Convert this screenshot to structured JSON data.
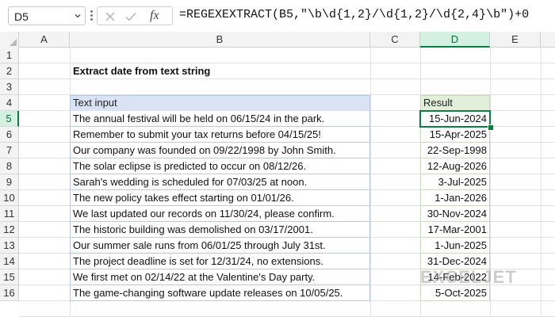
{
  "toolbar": {
    "name_box": "D5",
    "formula": "=REGEXEXTRACT(B5,\"\\b\\d{1,2}/\\d{1,2}/\\d{2,4}\\b\")+0",
    "fx_label": "fx",
    "cancel_icon": "x-icon",
    "enter_icon": "check-icon"
  },
  "columns": [
    "A",
    "B",
    "C",
    "D",
    "E"
  ],
  "selected_column": "D",
  "rows": [
    "1",
    "2",
    "3",
    "4",
    "5",
    "6",
    "7",
    "8",
    "9",
    "10",
    "11",
    "12",
    "13",
    "14",
    "15",
    "16"
  ],
  "selected_row": "5",
  "sheet": {
    "title": "Extract date from text string",
    "text_header": "Text input",
    "result_header": "Result",
    "entries": [
      {
        "text": "The annual festival will be held on 06/15/24 in the park.",
        "result": "15-Jun-2024"
      },
      {
        "text": "Remember to submit your tax returns before 04/15/25!",
        "result": "15-Apr-2025"
      },
      {
        "text": "Our company was founded on 09/22/1998 by John Smith.",
        "result": "22-Sep-1998"
      },
      {
        "text": "The solar eclipse is predicted to occur on 08/12/26.",
        "result": "12-Aug-2026"
      },
      {
        "text": "Sarah's wedding is scheduled for 07/03/25 at noon.",
        "result": "3-Jul-2025"
      },
      {
        "text": "The new policy takes effect starting on 01/01/26.",
        "result": "1-Jan-2026"
      },
      {
        "text": "We last updated our records on 11/30/24, please confirm.",
        "result": "30-Nov-2024"
      },
      {
        "text": "The historic building was demolished on 03/17/2001.",
        "result": "17-Mar-2001"
      },
      {
        "text": "Our summer sale runs from 06/01/25 through July 31st.",
        "result": "1-Jun-2025"
      },
      {
        "text": "The project deadline is set for 12/31/24, no extensions.",
        "result": "31-Dec-2024"
      },
      {
        "text": "We first met on 02/14/22 at the Valentine's Day party.",
        "result": "14-Feb-2022"
      },
      {
        "text": "The game-changing software update releases on 10/05/25.",
        "result": "5-Oct-2025"
      }
    ]
  },
  "watermark": "EXCELJET",
  "colors": {
    "accent": "#107c41",
    "text_header_bg": "#dae3f3",
    "result_header_bg": "#e2efda"
  }
}
